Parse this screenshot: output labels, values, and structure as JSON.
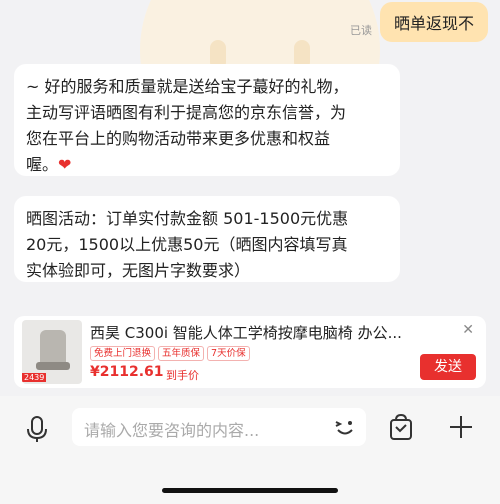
{
  "chat": {
    "outgoing": {
      "text": "晒单返现不",
      "status": "已读"
    },
    "messages": [
      {
        "line1": "~ 好的服务和质量就是送给宝子蕞好的礼物，",
        "line2": "主动写评语晒图有利于提高您的京东信誉，为",
        "line3": "您在平台上的购物活动带来更多优惠和权益",
        "line4": "喔。",
        "heart": "❤"
      },
      {
        "line1": "晒图活动：订单实付款金额  501-1500元优惠",
        "line2": "20元，1500以上优惠50元（晒图内容填写真",
        "line3": "实体验即可，无图片字数要求）"
      }
    ]
  },
  "product": {
    "title": "西昊 C300i 智能人体工学椅按摩电脑椅 办公...",
    "tags": [
      "免费上门退换",
      "五年质保",
      "7天价保"
    ],
    "price": "¥2112.61",
    "price_note": "到手价",
    "thumb_price": "2439",
    "send_label": "发送",
    "close_icon": "close-icon"
  },
  "input_bar": {
    "placeholder": "请输入您要咨询的内容..."
  },
  "colors": {
    "accent": "#e8302e",
    "bubble_out": "#ffe3b0"
  }
}
